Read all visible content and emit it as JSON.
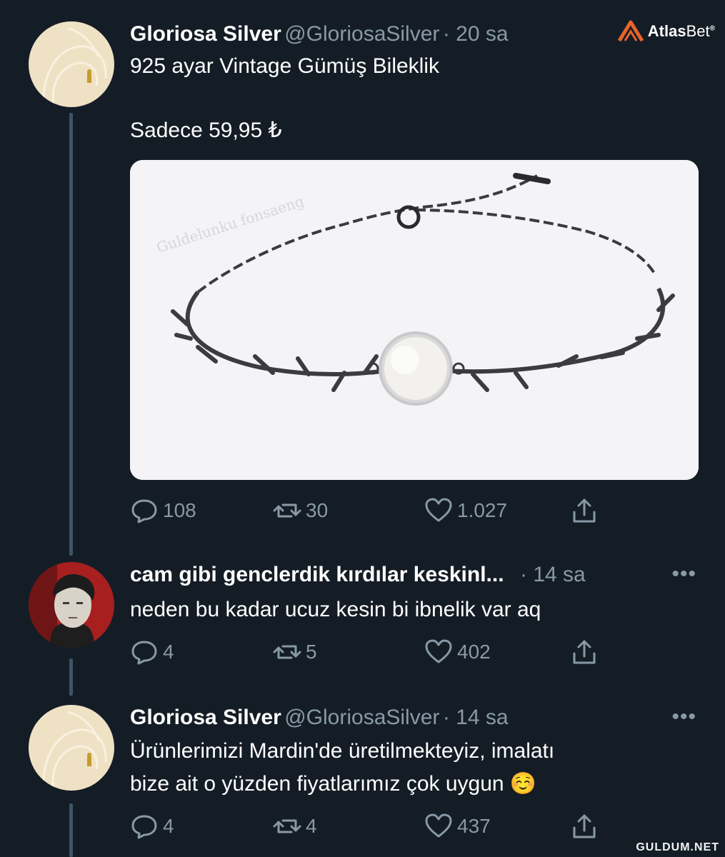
{
  "brand": {
    "name_bold": "Atlas",
    "name_light": "Bet",
    "mark": "®"
  },
  "watermark": "GULDUM.NET",
  "tweets": [
    {
      "name": "Gloriosa Silver",
      "handle": "@GloriosaSilver",
      "time": "· 20 sa",
      "lines": [
        "925 ayar Vintage Gümüş Bileklik",
        "",
        "Sadece 59,95 ₺"
      ],
      "actions": {
        "reply": "108",
        "retweet": "30",
        "like": "1.027"
      },
      "media_text": "Guldelunku fonsaeng"
    },
    {
      "name": "cam gibi genclerdik kırdılar keskinl...",
      "handle": "",
      "time": "· 14 sa",
      "lines": [
        "neden bu kadar ucuz kesin bi ibnelik var aq"
      ],
      "actions": {
        "reply": "4",
        "retweet": "5",
        "like": "402"
      },
      "more": "•••"
    },
    {
      "name": "Gloriosa Silver",
      "handle": "@GloriosaSilver",
      "time": "· 14 sa",
      "lines": [
        "Ürünlerimizi Mardin'de üretilmekteyiz, imalatı",
        "bize ait o yüzden fiyatlarımız çok uygun ☺️"
      ],
      "actions": {
        "reply": "4",
        "retweet": "4",
        "like": "437"
      },
      "more": "•••"
    }
  ],
  "colors": {
    "background": "#141d26",
    "muted": "#8899a6",
    "thread": "#3d5466"
  }
}
